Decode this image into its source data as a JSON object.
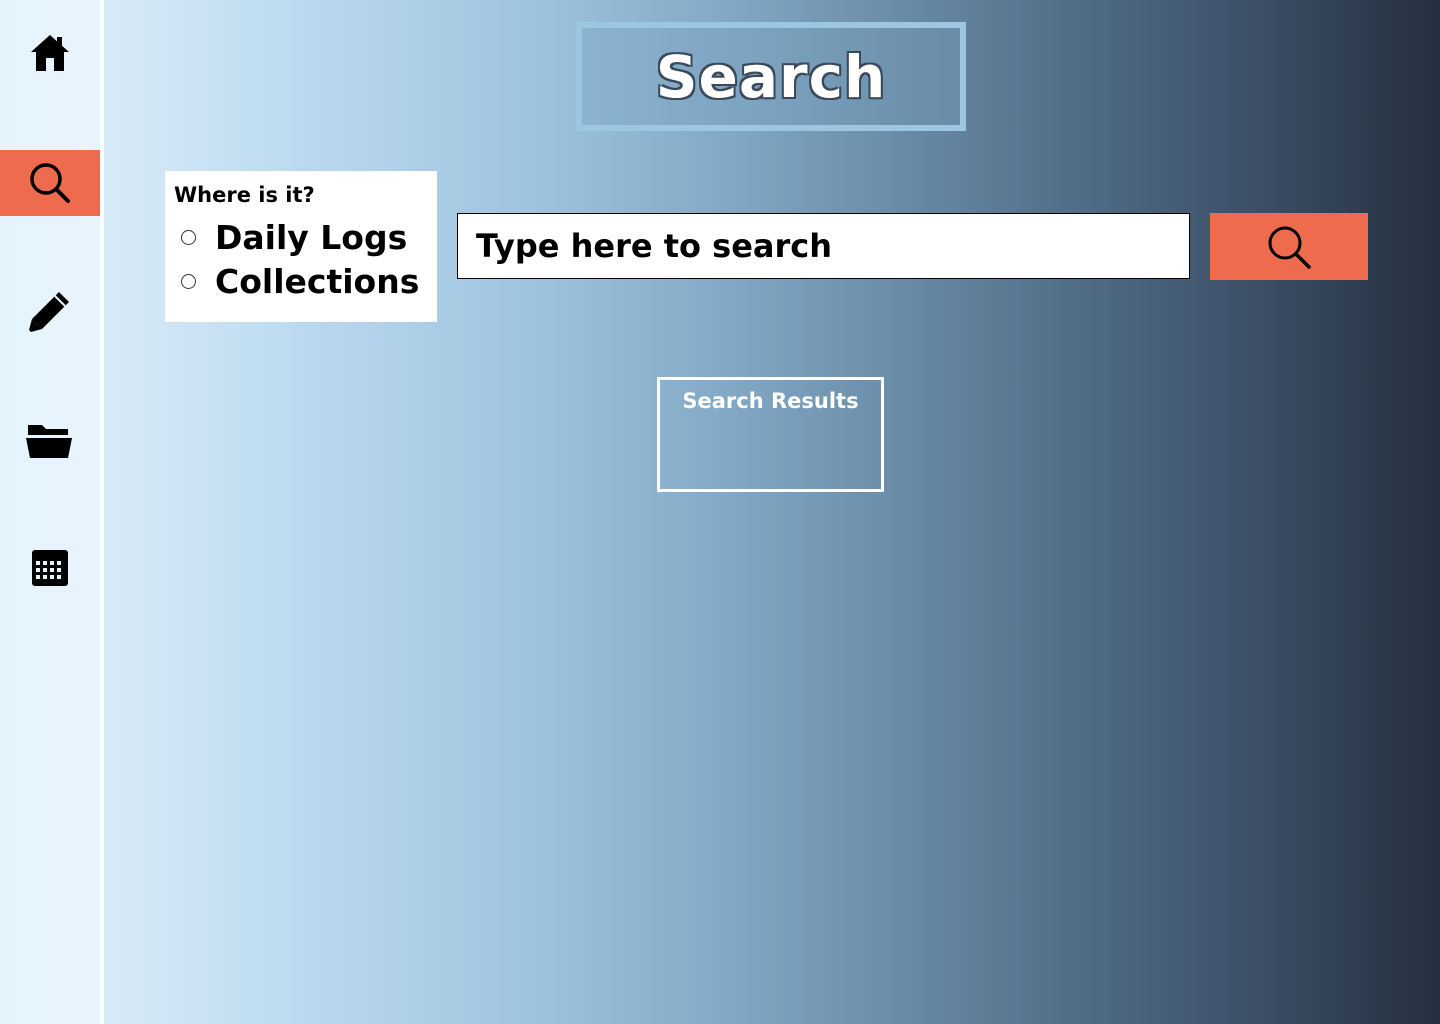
{
  "sidebar": {
    "items": [
      {
        "name": "home",
        "icon": "home-icon"
      },
      {
        "name": "search",
        "icon": "search-icon",
        "active": true
      },
      {
        "name": "edit",
        "icon": "pencil-icon"
      },
      {
        "name": "collections",
        "icon": "folder-open-icon"
      },
      {
        "name": "calendar",
        "icon": "calendar-icon"
      }
    ]
  },
  "header": {
    "title": "Search"
  },
  "filter": {
    "label": "Where is it?",
    "options": [
      {
        "label": "Daily Logs",
        "selected": false
      },
      {
        "label": "Collections",
        "selected": false
      }
    ]
  },
  "search": {
    "placeholder": "Type here to search",
    "value": "",
    "button_icon": "search-icon"
  },
  "results": {
    "label": "Search Results"
  },
  "colors": {
    "accent": "#ee6c4d",
    "sidebar_bg": "#e7f4fd",
    "title_border": "#9cc6e2",
    "gradient_start": "#e6f3fc",
    "gradient_end": "#262f3f"
  }
}
